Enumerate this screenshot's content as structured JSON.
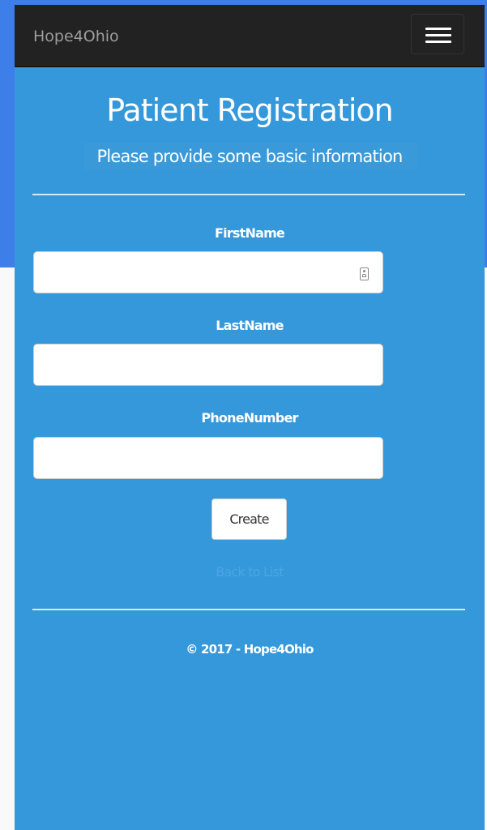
{
  "navbar": {
    "brand": "Hope4Ohio",
    "menu_icon": "hamburger-menu-icon"
  },
  "header": {
    "title": "Patient Registration",
    "subtitle": "Please provide some basic information"
  },
  "form": {
    "fields": [
      {
        "label": "FirstName",
        "value": "",
        "icon": "autofill-contact-icon"
      },
      {
        "label": "LastName",
        "value": ""
      },
      {
        "label": "PhoneNumber",
        "value": ""
      }
    ],
    "submit_label": "Create",
    "back_link": "Back to List"
  },
  "footer": {
    "text": "© 2017 - Hope4Ohio"
  },
  "colors": {
    "page_background": "#3498db",
    "navbar": "#222222",
    "outer_background": "#3d7ee8"
  }
}
